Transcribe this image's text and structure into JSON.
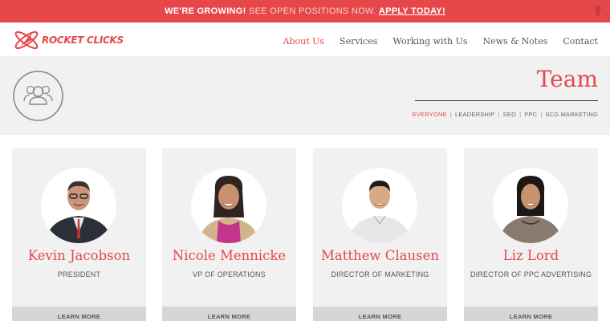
{
  "topbar": {
    "growing": "WE'RE GROWING!",
    "positions": "SEE OPEN POSITIONS NOW.",
    "apply": "APPLY TODAY!",
    "icon": "up-arrow-icon"
  },
  "brand": {
    "logo_text": "ROCKET CLICKS",
    "color": "#e5474b"
  },
  "nav": {
    "items": [
      "About Us",
      "Services",
      "Working with Us",
      "News & Notes",
      "Contact"
    ],
    "active": "About Us"
  },
  "hero": {
    "icon": "team-icon",
    "title": "Team",
    "filters": [
      "EVERYONE",
      "LEADERSHIP",
      "SEO",
      "PPC",
      "SCG MARKETING"
    ],
    "active_filter": "EVERYONE"
  },
  "team": [
    {
      "name": "Kevin Jacobson",
      "role": "PRESIDENT",
      "button": "LEARN MORE"
    },
    {
      "name": "Nicole Mennicke",
      "role": "VP OF OPERATIONS",
      "button": "LEARN MORE"
    },
    {
      "name": "Matthew Clausen",
      "role": "DIRECTOR OF MARKETING",
      "button": "LEARN MORE"
    },
    {
      "name": "Liz Lord",
      "role": "DIRECTOR OF PPC ADVERTISING",
      "button": "LEARN MORE"
    }
  ]
}
